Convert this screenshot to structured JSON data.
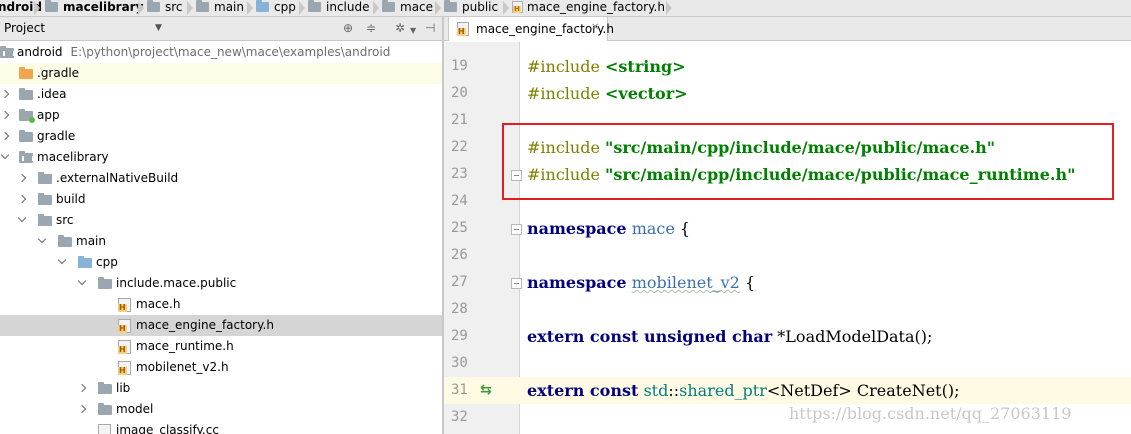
{
  "breadcrumb": [
    "ndroid",
    "macelibrary",
    "src",
    "main",
    "cpp",
    "include",
    "mace",
    "public",
    "mace_engine_factory.h"
  ],
  "project_panel": {
    "title": "Project",
    "tree": [
      {
        "label": "android",
        "path": "E:\\python\\project\\mace_new\\mace\\examples\\android",
        "depth": 0,
        "icon": "module-folder-icon",
        "expanded": true
      },
      {
        "label": ".gradle",
        "depth": 1,
        "icon": "folder-icon-orange",
        "expanded": false,
        "highlight": true
      },
      {
        "label": ".idea",
        "depth": 1,
        "icon": "folder-icon",
        "expanded": false
      },
      {
        "label": "app",
        "depth": 1,
        "icon": "module-folder-icon",
        "expanded": false
      },
      {
        "label": "gradle",
        "depth": 1,
        "icon": "folder-icon",
        "expanded": false
      },
      {
        "label": "macelibrary",
        "depth": 1,
        "icon": "module-folder-icon",
        "expanded": true
      },
      {
        "label": ".externalNativeBuild",
        "depth": 2,
        "icon": "folder-icon",
        "expanded": false
      },
      {
        "label": "build",
        "depth": 2,
        "icon": "folder-icon",
        "expanded": false
      },
      {
        "label": "src",
        "depth": 2,
        "icon": "folder-icon",
        "expanded": true
      },
      {
        "label": "main",
        "depth": 3,
        "icon": "folder-icon",
        "expanded": true
      },
      {
        "label": "cpp",
        "depth": 4,
        "icon": "folder-icon-blue",
        "expanded": true
      },
      {
        "label": "include.mace.public",
        "depth": 5,
        "icon": "folder-icon",
        "expanded": true
      },
      {
        "label": "mace.h",
        "depth": 6,
        "icon": "header-file-icon"
      },
      {
        "label": "mace_engine_factory.h",
        "depth": 6,
        "icon": "header-file-icon",
        "selected": true
      },
      {
        "label": "mace_runtime.h",
        "depth": 6,
        "icon": "header-file-icon"
      },
      {
        "label": "mobilenet_v2.h",
        "depth": 6,
        "icon": "header-file-icon"
      },
      {
        "label": "lib",
        "depth": 5,
        "icon": "folder-icon",
        "expanded": false
      },
      {
        "label": "model",
        "depth": 5,
        "icon": "folder-icon",
        "expanded": false
      },
      {
        "label": "image_classify.cc",
        "depth": 5,
        "icon": "cpp-file-icon"
      }
    ]
  },
  "editor": {
    "tab_label": "mace_engine_factory.h",
    "lines": [
      {
        "n": "19",
        "code": "#include <string>"
      },
      {
        "n": "20",
        "code": "#include <vector>"
      },
      {
        "n": "21",
        "code": ""
      },
      {
        "n": "22",
        "code": "#include \"src/main/cpp/include/mace/public/mace.h\""
      },
      {
        "n": "23",
        "code": "#include \"src/main/cpp/include/mace/public/mace_runtime.h\""
      },
      {
        "n": "24",
        "code": ""
      },
      {
        "n": "25",
        "code": "namespace mace {"
      },
      {
        "n": "26",
        "code": ""
      },
      {
        "n": "27",
        "code": "namespace mobilenet_v2 {"
      },
      {
        "n": "28",
        "code": ""
      },
      {
        "n": "29",
        "code": "extern const unsigned char *LoadModelData();"
      },
      {
        "n": "30",
        "code": ""
      },
      {
        "n": "31",
        "code": "extern const std::shared_ptr<NetDef> CreateNet();"
      },
      {
        "n": "32",
        "code": ""
      }
    ],
    "watermark": "https://blog.csdn.net/qq_27063119"
  },
  "colors": {
    "keyword": "#000080",
    "string": "#008000",
    "preprocessor": "#808000",
    "highlight_box": "#e02020"
  }
}
